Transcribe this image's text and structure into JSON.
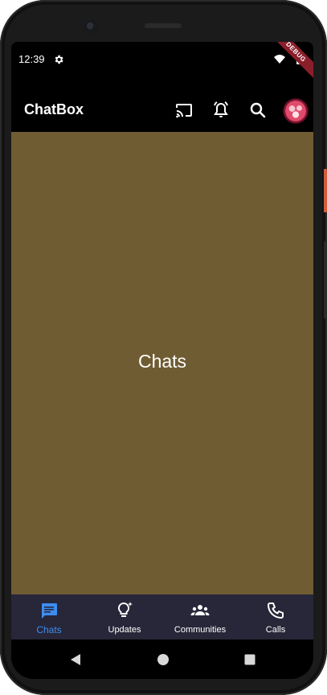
{
  "status_bar": {
    "time": "12:39",
    "icons": [
      "settings-gear-icon",
      "wifi-icon",
      "battery-icon"
    ],
    "debug_banner": "DEBUG"
  },
  "app_bar": {
    "title": "ChatBox",
    "actions": [
      {
        "icon": "cast-icon"
      },
      {
        "icon": "notification-bell-icon"
      },
      {
        "icon": "search-icon"
      }
    ],
    "avatar": "profile-avatar"
  },
  "content": {
    "label": "Chats",
    "background_color": "#6f5c33"
  },
  "bottom_nav": {
    "background_color": "#272739",
    "active_color": "#3d8cf0",
    "items": [
      {
        "label": "Chats",
        "icon": "chat-bubble-icon",
        "active": true
      },
      {
        "label": "Updates",
        "icon": "lightbulb-sparkle-icon",
        "active": false
      },
      {
        "label": "Communities",
        "icon": "groups-icon",
        "active": false
      },
      {
        "label": "Calls",
        "icon": "phone-icon",
        "active": false
      }
    ]
  },
  "system_nav": {
    "buttons": [
      "back-triangle-icon",
      "home-circle-icon",
      "recents-square-icon"
    ]
  }
}
